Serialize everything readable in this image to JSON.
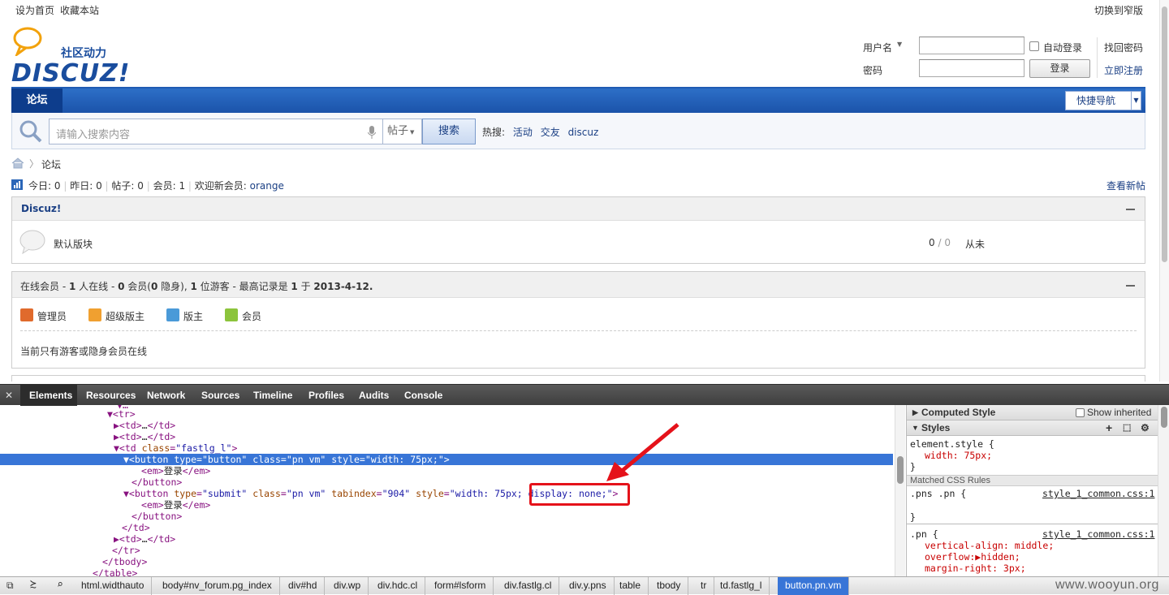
{
  "topbar": {
    "set_home": "设为首页",
    "bookmark": "收藏本站",
    "switch_narrow": "切换到窄版"
  },
  "logo": {
    "tagline": "社区动力",
    "brand": "DISCUZ!"
  },
  "login": {
    "username_label": "用户名",
    "password_label": "密码",
    "auto_login": "自动登录",
    "login_button": "登录",
    "forgot": "找回密码",
    "register": "立即注册"
  },
  "nav": {
    "forum": "论坛",
    "quick_nav": "快捷导航"
  },
  "search": {
    "placeholder": "请输入搜索内容",
    "type": "帖子",
    "button": "搜索",
    "hot_label": "热搜:",
    "hot": [
      "活动",
      "交友",
      "discuz"
    ]
  },
  "breadcrumb": {
    "current": "论坛"
  },
  "stats": {
    "today_label": "今日:",
    "today": "0",
    "yesterday_label": "昨日:",
    "yesterday": "0",
    "posts_label": "帖子:",
    "posts": "0",
    "members_label": "会员:",
    "members": "1",
    "welcome": "欢迎新会员:",
    "new_member": "orange",
    "new_posts": "查看新帖"
  },
  "category": {
    "title": "Discuz!",
    "forum_name": "默认版块",
    "counts_a": "0",
    "sep": "/",
    "counts_b": "0",
    "last": "从未"
  },
  "online": {
    "text_1": "在线会员 - ",
    "n_online": "1",
    "text_2": " 人在线 - ",
    "n_members": "0",
    "text_3": " 会员(",
    "n_hidden": "0",
    "text_4": " 隐身), ",
    "n_guests": "1",
    "text_5": " 位游客 - 最高记录是 ",
    "n_record": "1",
    "text_6": " 于 ",
    "date": "2013-4-12.",
    "legend": [
      {
        "label": "管理员",
        "color": "#e06a2c"
      },
      {
        "label": "超级版主",
        "color": "#f0a030"
      },
      {
        "label": "版主",
        "color": "#4a9ad8"
      },
      {
        "label": "会员",
        "color": "#8cc43c"
      }
    ],
    "note": "当前只有游客或隐身会员在线"
  },
  "devtools": {
    "tabs": [
      "Elements",
      "Resources",
      "Network",
      "Sources",
      "Timeline",
      "Profiles",
      "Audits",
      "Console"
    ],
    "code_lines": [
      {
        "indent": 132,
        "text": "▼<tr>"
      },
      {
        "indent": 140,
        "text": "▶<td>…</td>"
      },
      {
        "indent": 140,
        "text": "▶<td>…</td>"
      },
      {
        "indent": 140,
        "text": "▼<td class=\"fastlg_l\">"
      },
      {
        "indent": 152,
        "text": "▼<button type=\"button\" class=\"pn vm\" style=\"width: 75px;\">",
        "selected": true
      },
      {
        "indent": 174,
        "text": "<em>登录</em>"
      },
      {
        "indent": 162,
        "text": "</button>"
      },
      {
        "indent": 152,
        "text": "▼<button type=\"submit\" class=\"pn vm\" tabindex=\"904\" style=\"width: 75px; display: none;\">"
      },
      {
        "indent": 174,
        "text": "<em>登录</em>"
      },
      {
        "indent": 162,
        "text": "</button>"
      },
      {
        "indent": 150,
        "text": "</td>"
      },
      {
        "indent": 140,
        "text": "▶<td>…</td>"
      },
      {
        "indent": 138,
        "text": "</tr>"
      },
      {
        "indent": 126,
        "text": "</tbody>"
      },
      {
        "indent": 114,
        "text": "</table>"
      }
    ],
    "sidebar": {
      "computed_style": "Computed Style",
      "show_inherited": "Show inherited",
      "styles": "Styles",
      "element_style": "element.style {",
      "width_rule": "width: 75px;",
      "close_brace": "}",
      "matched": "Matched CSS Rules",
      "rule1_selector": ".pns .pn {",
      "rule1_source": "style_1_common.css:1",
      "rule2_selector": ".pn {",
      "rule2_source": "style_1_common.css:1",
      "rule2_props": [
        "vertical-align: middle;",
        "overflow:▶hidden;",
        "margin-right: 3px;"
      ]
    },
    "breadcrumbs": [
      "html.widthauto",
      "body#nv_forum.pg_index",
      "div#hd",
      "div.wp",
      "div.hdc.cl",
      "form#lsform",
      "div.fastlg.cl",
      "div.y.pns",
      "table",
      "tbody",
      "tr",
      "td.fastlg_l",
      "button.pn.vm"
    ]
  },
  "watermark": "www.wooyun.org"
}
